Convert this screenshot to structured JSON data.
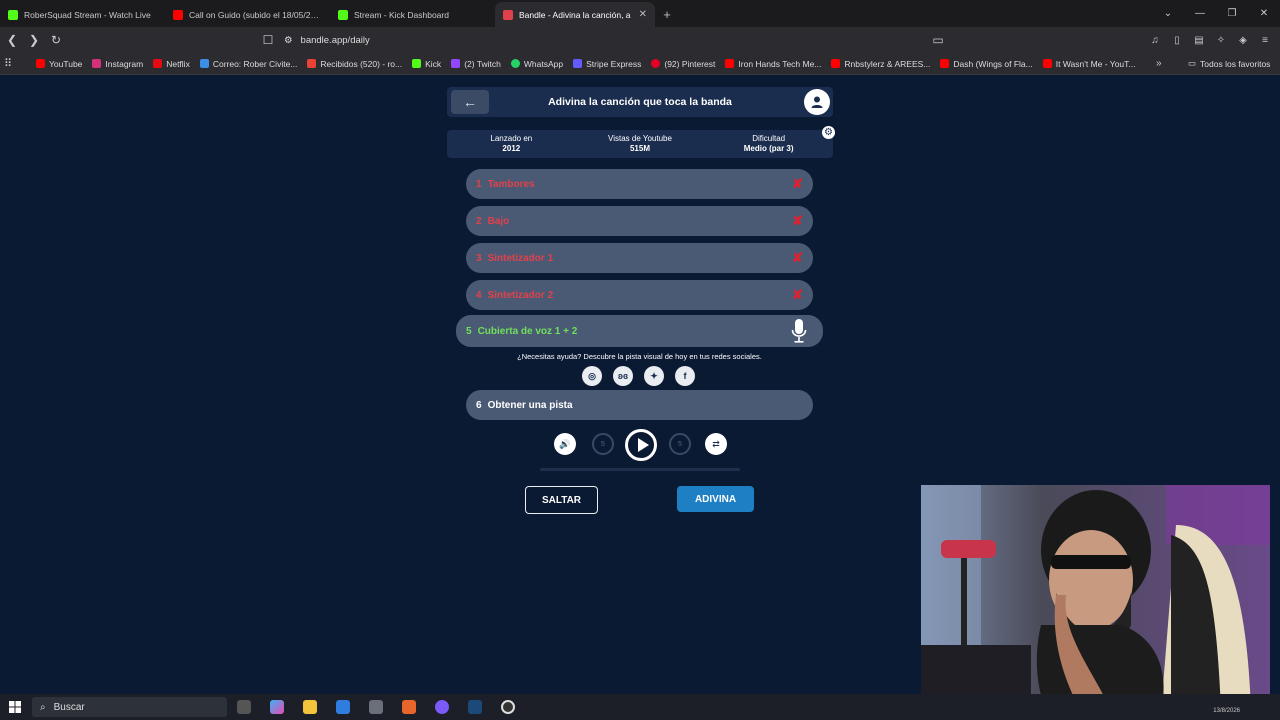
{
  "browser": {
    "tabs": [
      {
        "title": "RoberSquad Stream - Watch Live",
        "icon_color": "#53fc18",
        "active": false
      },
      {
        "title": "Call on Guido (subido el 18/05/2017)",
        "icon_color": "#ff0000",
        "active": false
      },
      {
        "title": "Stream - Kick Dashboard",
        "icon_color": "#53fc18",
        "active": false
      },
      {
        "title": "Bandle - Adivina la canción, a",
        "icon_color": "#e0414b",
        "active": true
      }
    ],
    "url": "bandle.app/daily",
    "bookmarks": [
      {
        "label": "YouTube",
        "color": "#ff0000"
      },
      {
        "label": "Instagram",
        "color": "#d6307a"
      },
      {
        "label": "Netflix",
        "color": "#e50914"
      },
      {
        "label": "Correo: Rober Civite...",
        "color": "#3a8ee6"
      },
      {
        "label": "Recibidos (520) - ro...",
        "color": "#ea4335"
      },
      {
        "label": "Kick",
        "color": "#53fc18"
      },
      {
        "label": "(2) Twitch",
        "color": "#9146ff"
      },
      {
        "label": "WhatsApp",
        "color": "#25d366"
      },
      {
        "label": "Stripe Express",
        "color": "#635bff"
      },
      {
        "label": "(92) Pinterest",
        "color": "#e60023"
      },
      {
        "label": "Iron Hands Tech Me...",
        "color": "#ff0000"
      },
      {
        "label": "Rnbstylerz & AREES...",
        "color": "#ff0000"
      },
      {
        "label": "Dash (Wings of Fla...",
        "color": "#ff0000"
      },
      {
        "label": "It Wasn't Me - YouT...",
        "color": "#ff0000"
      }
    ],
    "all_bookmarks": "Todos los favoritos"
  },
  "game": {
    "title": "Adivina la canción que toca la banda",
    "info": [
      {
        "label": "Lanzado en",
        "value": "2012"
      },
      {
        "label": "Vistas de Youtube",
        "value": "515M"
      },
      {
        "label": "Dificultad",
        "value": "Medio (par 3)"
      }
    ],
    "tracks": [
      {
        "num": "1",
        "label": "Tambores",
        "state": "failed"
      },
      {
        "num": "2",
        "label": "Bajo",
        "state": "failed"
      },
      {
        "num": "3",
        "label": "Sintetizador 1",
        "state": "failed"
      },
      {
        "num": "4",
        "label": "Sintetizador 2",
        "state": "failed"
      }
    ],
    "current_track": {
      "num": "5",
      "label": "Cubierta de voz 1 + 2"
    },
    "help_text": "¿Necesitas ayuda? Descubre la pista visual de hoy en tus redes sociales.",
    "hint_track": {
      "num": "6",
      "label": "Obtener una pista"
    },
    "player": {
      "rewind_label": "5",
      "forward_label": "5",
      "progress": 0.0
    },
    "skip_label": "SALTAR",
    "guess_label": "ADIVINA"
  },
  "taskbar": {
    "search_placeholder": "Buscar",
    "date": "13/8/2026"
  },
  "colors": {
    "page_bg": "#0b1a33",
    "panel": "#1a2d4e",
    "track": "#4b5a74",
    "failed": "#e0414b",
    "current": "#6fe05a",
    "accent": "#1f7fc4"
  }
}
